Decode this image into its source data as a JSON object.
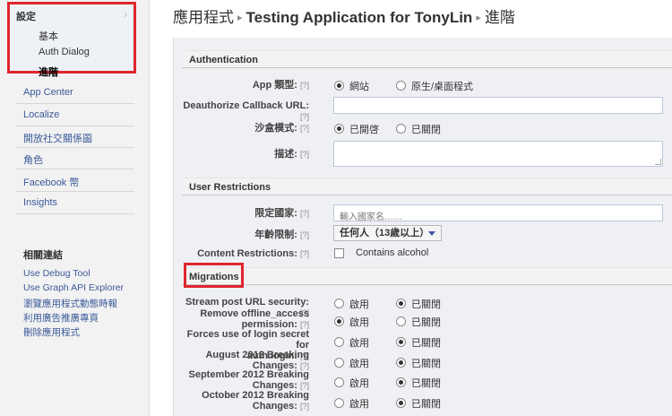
{
  "sidebar": {
    "settings_label": "設定",
    "sub_items": [
      "基本",
      "Auth Dialog",
      "進階"
    ],
    "links": [
      "App Center",
      "Localize",
      "開放社交關係圖",
      "角色",
      "Facebook 幣",
      "Insights"
    ],
    "related_title": "相關連結",
    "related_links": [
      "Use Debug Tool",
      "Use Graph API Explorer",
      "瀏覽應用程式動態時報",
      "利用廣告推廣專頁",
      "刪除應用程式"
    ]
  },
  "breadcrumb": {
    "root": "應用程式",
    "app_name": "Testing Application for TonyLin",
    "page": "進階",
    "separator": "▸"
  },
  "help": "[?]",
  "authentication": {
    "title": "Authentication",
    "app_type_label": "App 類型:",
    "app_type_options": [
      "網站",
      "原生/桌面程式"
    ],
    "deauth_label": "Deauthorize Callback URL:",
    "deauth_value": "",
    "sandbox_label": "沙盒模式:",
    "sandbox_options": [
      "已開啓",
      "已關閉"
    ],
    "description_label": "描述:",
    "description_value": ""
  },
  "user_restrictions": {
    "title": "User Restrictions",
    "country_label": "限定國家:",
    "country_placeholder": "輸入國家名……",
    "age_label": "年齡限制:",
    "age_value": "任何人（13歲以上）",
    "content_label": "Content Restrictions:",
    "content_option": "Contains alcohol"
  },
  "migrations": {
    "title": "Migrations",
    "on_label": "啟用",
    "off_label": "已關閉",
    "rows": [
      {
        "label_1": "Stream post URL security:",
        "label_2": "",
        "selected": "off"
      },
      {
        "label_1": "Remove offline_access",
        "label_2": "permission:",
        "selected": "on"
      },
      {
        "label_1": "Forces use of login secret for",
        "label_2": "auth.login:",
        "selected": "off"
      },
      {
        "label_1": "August 2012 Breaking",
        "label_2": "Changes:",
        "selected": "off"
      },
      {
        "label_1": "September 2012 Breaking",
        "label_2": "Changes:",
        "selected": "off"
      },
      {
        "label_1": "October 2012 Breaking",
        "label_2": "Changes:",
        "selected": "off"
      }
    ]
  },
  "colors": {
    "highlight": "#e0262e",
    "link": "#3b5998"
  }
}
